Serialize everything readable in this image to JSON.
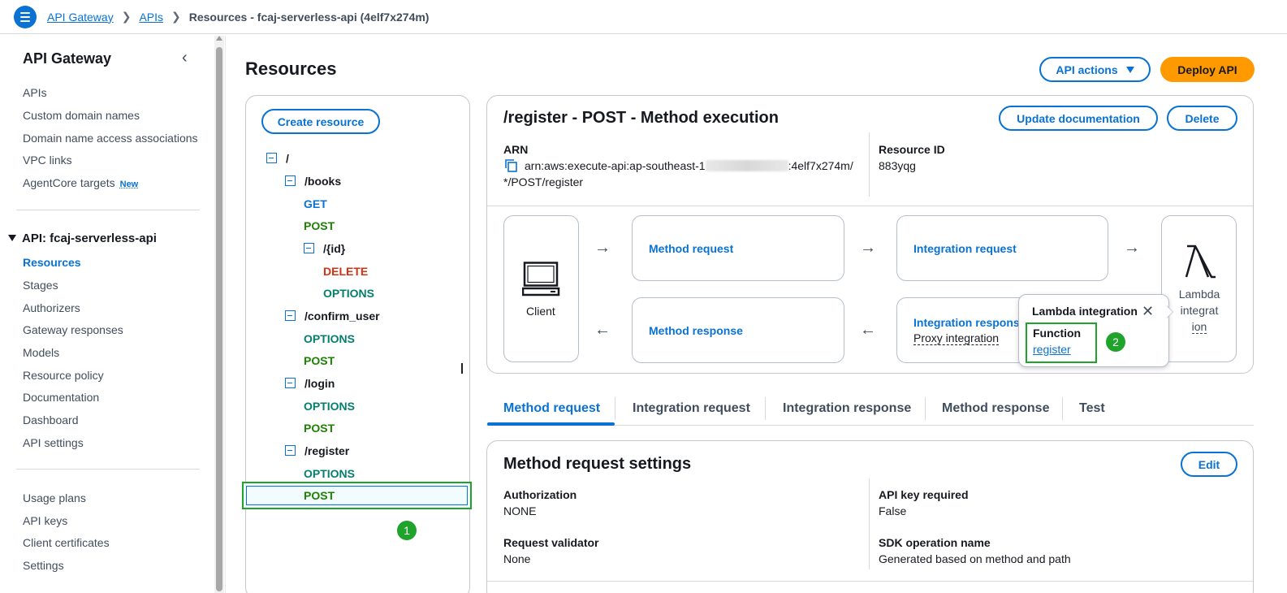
{
  "breadcrumb": {
    "items": [
      "API Gateway",
      "APIs"
    ],
    "current": "Resources - fcaj-serverless-api (4elf7x274m)"
  },
  "sidebar": {
    "title": "API Gateway",
    "top_items": [
      {
        "label": "APIs"
      },
      {
        "label": "Custom domain names"
      },
      {
        "label": "Domain name access associations"
      },
      {
        "label": "VPC links"
      },
      {
        "label": "AgentCore targets",
        "badge": "New"
      }
    ],
    "api_section": "API: fcaj-serverless-api",
    "api_items": [
      {
        "label": "Resources",
        "active": true
      },
      {
        "label": "Stages"
      },
      {
        "label": "Authorizers"
      },
      {
        "label": "Gateway responses"
      },
      {
        "label": "Models"
      },
      {
        "label": "Resource policy"
      },
      {
        "label": "Documentation"
      },
      {
        "label": "Dashboard"
      },
      {
        "label": "API settings"
      }
    ],
    "bottom_items": [
      {
        "label": "Usage plans"
      },
      {
        "label": "API keys"
      },
      {
        "label": "Client certificates"
      },
      {
        "label": "Settings"
      }
    ]
  },
  "header": {
    "title": "Resources",
    "api_actions": "API actions",
    "deploy": "Deploy API"
  },
  "tree": {
    "create_resource": "Create resource",
    "nodes": [
      {
        "label": "/"
      },
      {
        "label": "/books"
      },
      {
        "label": "GET"
      },
      {
        "label": "POST"
      },
      {
        "label": "/{id}"
      },
      {
        "label": "DELETE"
      },
      {
        "label": "OPTIONS"
      },
      {
        "label": "/confirm_user"
      },
      {
        "label": "OPTIONS"
      },
      {
        "label": "POST"
      },
      {
        "label": "/login"
      },
      {
        "label": "OPTIONS"
      },
      {
        "label": "POST"
      },
      {
        "label": "/register"
      },
      {
        "label": "OPTIONS"
      },
      {
        "label": "POST"
      }
    ],
    "step_badge": "1"
  },
  "execution": {
    "title": "/register - POST - Method execution",
    "update_doc": "Update documentation",
    "delete": "Delete",
    "arn_label": "ARN",
    "arn_prefix": "arn:aws:execute-api:ap-southeast-1",
    "arn_suffix": ":4elf7x274m/",
    "arn_line2": "*/POST/register",
    "resource_id_label": "Resource ID",
    "resource_id": "883yqg",
    "client": "Client",
    "method_request": "Method request",
    "integration_request": "Integration request",
    "method_response": "Method response",
    "integration_response": "Integration respons",
    "proxy": "Proxy integration",
    "lambda_line1": "Lambda",
    "lambda_line2": "integrat",
    "lambda_line3": "ion"
  },
  "popover": {
    "title": "Lambda integration",
    "function_label": "Function",
    "function_link": "register",
    "step_badge": "2"
  },
  "tabs": [
    "Method request",
    "Integration request",
    "Integration response",
    "Method response",
    "Test"
  ],
  "settings": {
    "title": "Method request settings",
    "edit": "Edit",
    "authorization_label": "Authorization",
    "authorization": "NONE",
    "api_key_label": "API key required",
    "api_key": "False",
    "validator_label": "Request validator",
    "validator": "None",
    "sdk_label": "SDK operation name",
    "sdk": "Generated based on method and path"
  }
}
